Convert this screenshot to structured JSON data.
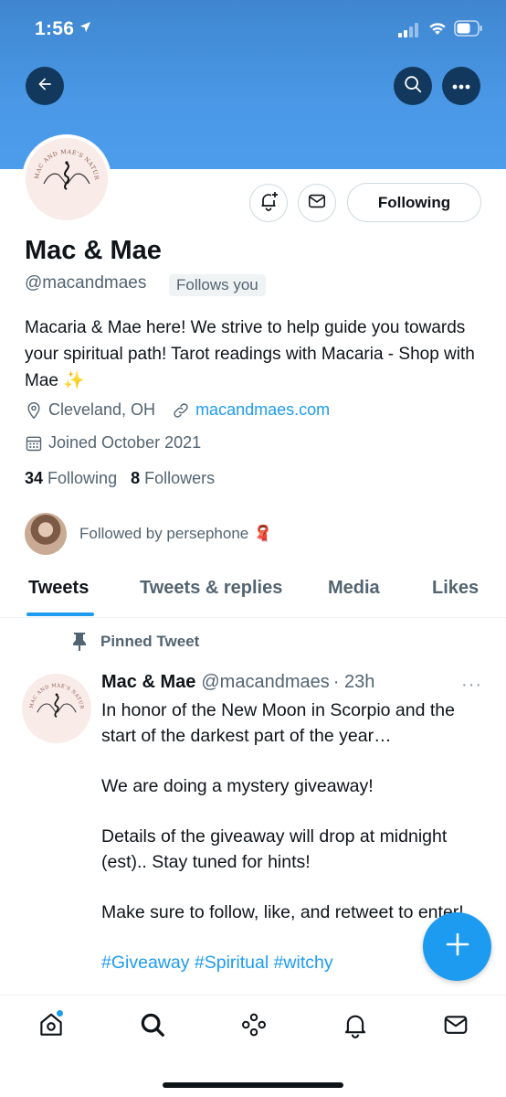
{
  "status_bar": {
    "time": "1:56"
  },
  "header": {
    "back_icon": "arrow-left-icon",
    "search_icon": "search-icon",
    "more_icon": "more-horizontal-icon",
    "banner_color": "#4a98e6"
  },
  "profile": {
    "avatar_text": "MAC AND MAE'S NATURAL MAGIC",
    "name": "Mac & Mae",
    "handle": "@macandmaes",
    "follows_you": "Follows you",
    "bio": "Macaria & Mae here! We strive to help guide you towards your spiritual path! Tarot readings with Macaria - Shop with Mae ✨",
    "location": "Cleveland, OH",
    "website": "macandmaes.com",
    "joined": "Joined October 2021",
    "following_count": "34",
    "following_label": "Following",
    "followers_count": "8",
    "followers_label": "Followers",
    "followed_by": "Followed by persephone 🧣"
  },
  "actions": {
    "following_button": "Following"
  },
  "tabs": [
    {
      "label": "Tweets",
      "active": true
    },
    {
      "label": "Tweets & replies"
    },
    {
      "label": "Media"
    },
    {
      "label": "Likes"
    }
  ],
  "pinned_tweet": {
    "pinned_label": "Pinned Tweet",
    "author_name": "Mac & Mae",
    "author_handle": "@macandmaes",
    "time": "· 23h",
    "more": "···",
    "paragraphs": [
      "In honor of the New Moon in Scorpio and the start of the darkest part of the year…",
      "We are doing a mystery giveaway!",
      "Details of the giveaway will drop at midnight (est).. Stay tuned for hints!",
      "Make sure to follow, like, and retweet to enter!"
    ],
    "hashtags": "#Giveaway #Spiritual #witchy"
  },
  "colors": {
    "accent": "#1d9bf0",
    "text": "#0f1419",
    "secondary": "#536471"
  }
}
